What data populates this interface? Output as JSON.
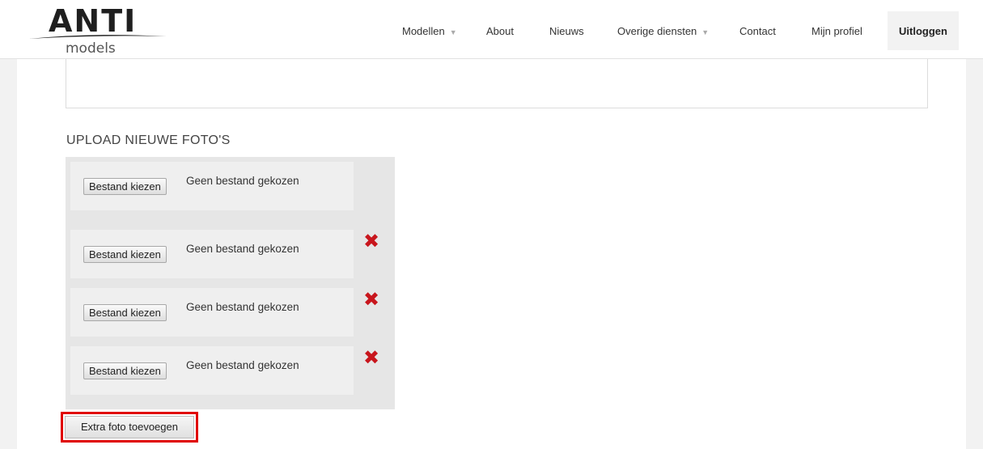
{
  "header": {
    "logo_text": "ANTI",
    "logo_subtext": "models",
    "nav": [
      {
        "label": "Modellen",
        "has_dropdown": true
      },
      {
        "label": "About",
        "has_dropdown": false
      },
      {
        "label": "Nieuws",
        "has_dropdown": false
      },
      {
        "label": "Overige diensten",
        "has_dropdown": true
      },
      {
        "label": "Contact",
        "has_dropdown": false
      },
      {
        "label": "Mijn profiel",
        "has_dropdown": false
      },
      {
        "label": "Uitloggen",
        "has_dropdown": false,
        "active": true
      }
    ],
    "caret": "▼"
  },
  "upload": {
    "title": "UPLOAD NIEUWE FOTO'S",
    "rows": [
      {
        "button_label": "Bestand kiezen",
        "status": "Geen bestand gekozen",
        "removable": false
      },
      {
        "button_label": "Bestand kiezen",
        "status": "Geen bestand gekozen",
        "removable": true
      },
      {
        "button_label": "Bestand kiezen",
        "status": "Geen bestand gekozen",
        "removable": true
      },
      {
        "button_label": "Bestand kiezen",
        "status": "Geen bestand gekozen",
        "removable": true
      }
    ],
    "remove_icon": "✖",
    "add_button_label": "Extra foto toevoegen"
  },
  "colors": {
    "remove_icon": "#c8161d",
    "highlight_border": "#e00000",
    "panel_bg": "#e6e6e6"
  }
}
